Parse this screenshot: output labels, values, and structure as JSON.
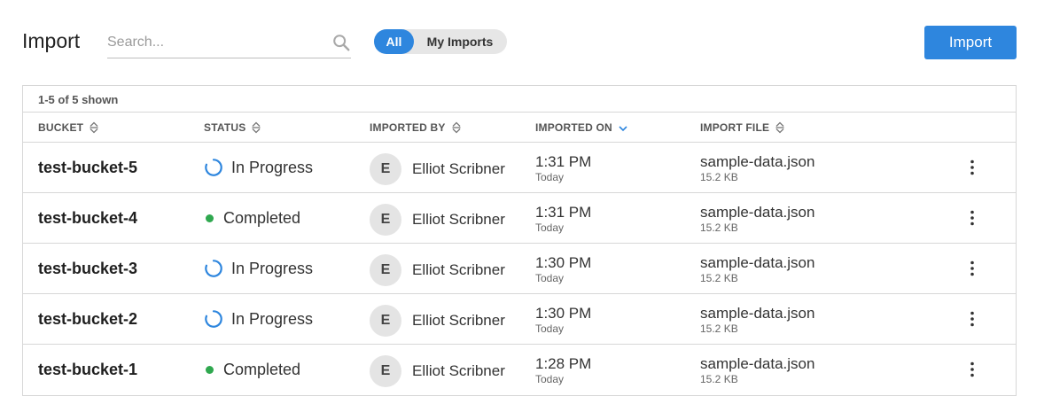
{
  "header": {
    "title": "Import",
    "search_placeholder": "Search...",
    "search_value": "",
    "filter_all": "All",
    "filter_mine": "My Imports",
    "filter_selected": "All",
    "import_button": "Import"
  },
  "table": {
    "summary": "1-5 of 5 shown",
    "columns": [
      "BUCKET",
      "STATUS",
      "IMPORTED BY",
      "IMPORTED ON",
      "IMPORT FILE"
    ],
    "sorted_column": "IMPORTED ON",
    "rows": [
      {
        "bucket": "test-bucket-5",
        "status": "In Progress",
        "status_icon": "spinner-icon",
        "avatar": "E",
        "user": "Elliot Scribner",
        "time": "1:31 PM",
        "day": "Today",
        "file": "sample-data.json",
        "size": "15.2 KB"
      },
      {
        "bucket": "test-bucket-4",
        "status": "Completed",
        "status_icon": "status-dot-icon",
        "avatar": "E",
        "user": "Elliot Scribner",
        "time": "1:31 PM",
        "day": "Today",
        "file": "sample-data.json",
        "size": "15.2 KB"
      },
      {
        "bucket": "test-bucket-3",
        "status": "In Progress",
        "status_icon": "spinner-icon",
        "avatar": "E",
        "user": "Elliot Scribner",
        "time": "1:30 PM",
        "day": "Today",
        "file": "sample-data.json",
        "size": "15.2 KB"
      },
      {
        "bucket": "test-bucket-2",
        "status": "In Progress",
        "status_icon": "spinner-icon",
        "avatar": "E",
        "user": "Elliot Scribner",
        "time": "1:30 PM",
        "day": "Today",
        "file": "sample-data.json",
        "size": "15.2 KB"
      },
      {
        "bucket": "test-bucket-1",
        "status": "Completed",
        "status_icon": "status-dot-icon",
        "avatar": "E",
        "user": "Elliot Scribner",
        "time": "1:28 PM",
        "day": "Today",
        "file": "sample-data.json",
        "size": "15.2 KB"
      }
    ]
  },
  "colors": {
    "accent": "#2e86de",
    "completed": "#2fa84f",
    "border": "#d7d7d7"
  }
}
